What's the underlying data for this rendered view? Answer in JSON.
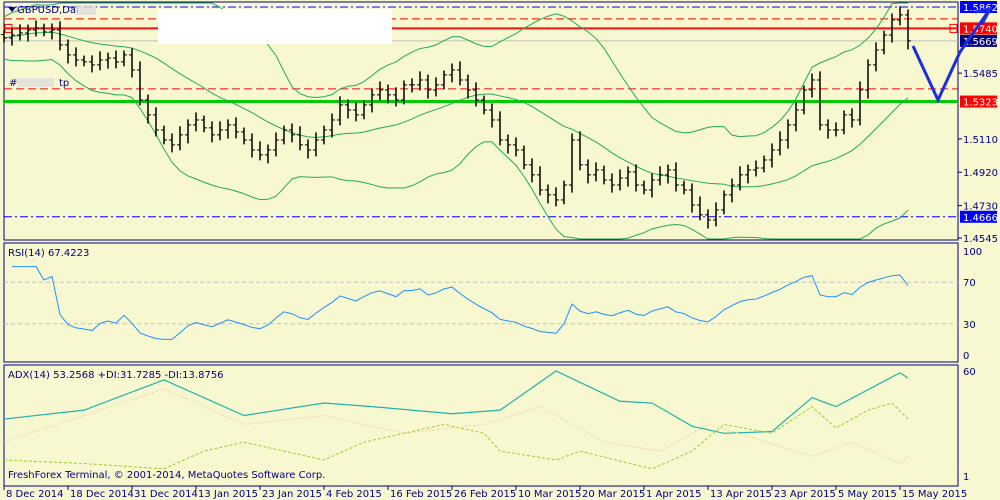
{
  "window": {
    "symbol_label": "GBPUSD,Dai",
    "order_label_prefix": "#",
    "order_label_suffix": "tp",
    "copyright": "FreshForex Terminal, © 2001-2014, MetaQuotes Software Corp."
  },
  "colors": {
    "background": "#f8f8d0",
    "axis": "#000080",
    "bars": "#000000",
    "bands": "#22aa55",
    "rsi": "#1e90ff",
    "adx": "#20b2aa",
    "plus_di": "#9acd32",
    "minus_di": "#f5cba7",
    "support": "#00cc00",
    "resistance": "#ff0000",
    "level_blue": "#0000ff",
    "arrow": "#1a2ee0"
  },
  "chart_data": [
    {
      "type": "ohlc",
      "title": "GBPUSD Daily",
      "ylim": [
        1.4545,
        1.5862
      ],
      "price_ticks": [
        "1.5485",
        "1.5110",
        "1.4920",
        "1.4730",
        "1.4545"
      ],
      "price_labels": [
        {
          "value": 1.5862,
          "text": "1.5862",
          "style": "blue"
        },
        {
          "value": 1.574,
          "text": "1.5740",
          "style": "red"
        },
        {
          "value": 1.5669,
          "text": "1.5669",
          "style": "navy"
        },
        {
          "value": 1.5323,
          "text": "1.5323",
          "style": "red"
        },
        {
          "value": 1.4666,
          "text": "1.4666",
          "style": "blue"
        }
      ],
      "levels": {
        "top_blue": 1.5862,
        "bottom_blue": 1.4666,
        "red_double": 1.574,
        "red_dash_top": 1.5794,
        "red_dash_tp": 1.5395,
        "green_support": 1.5323,
        "current": 1.5669
      },
      "x_labels": [
        {
          "bar": 0,
          "text": "8 Dec 2014"
        },
        {
          "bar": 8,
          "text": "18 Dec 2014"
        },
        {
          "bar": 16,
          "text": "31 Dec 2014"
        },
        {
          "bar": 24,
          "text": "13 Jan 2015"
        },
        {
          "bar": 32,
          "text": "23 Jan 2015"
        },
        {
          "bar": 40,
          "text": "4 Feb 2015"
        },
        {
          "bar": 48,
          "text": "16 Feb 2015"
        },
        {
          "bar": 56,
          "text": "26 Feb 2015"
        },
        {
          "bar": 64,
          "text": "10 Mar 2015"
        },
        {
          "bar": 72,
          "text": "20 Mar 2015"
        },
        {
          "bar": 80,
          "text": "1 Apr 2015"
        },
        {
          "bar": 88,
          "text": "13 Apr 2015"
        },
        {
          "bar": 96,
          "text": "23 Apr 2015"
        },
        {
          "bar": 104,
          "text": "5 May 2015"
        },
        {
          "bar": 112,
          "text": "15 May 2015"
        }
      ],
      "close": [
        1.5685,
        1.5702,
        1.5714,
        1.5731,
        1.5742,
        1.572,
        1.5731,
        1.5646,
        1.5589,
        1.556,
        1.5549,
        1.5532,
        1.556,
        1.5571,
        1.5549,
        1.5589,
        1.5503,
        1.5332,
        1.5247,
        1.5161,
        1.5104,
        1.5076,
        1.5133,
        1.519,
        1.5218,
        1.5173,
        1.5133,
        1.5161,
        1.519,
        1.515,
        1.5104,
        1.5047,
        1.5019,
        1.5047,
        1.5104,
        1.5161,
        1.5133,
        1.5076,
        1.5047,
        1.5104,
        1.5161,
        1.5218,
        1.5304,
        1.5275,
        1.5247,
        1.5304,
        1.5361,
        1.5389,
        1.5361,
        1.5332,
        1.5418,
        1.5418,
        1.5446,
        1.5389,
        1.5418,
        1.5475,
        1.5503,
        1.5446,
        1.5389,
        1.5332,
        1.5275,
        1.5218,
        1.5104,
        1.5076,
        1.5047,
        1.4962,
        1.4905,
        1.4819,
        1.4791,
        1.4762,
        1.4847,
        1.5104,
        1.4962,
        1.4905,
        1.4933,
        1.4876,
        1.4847,
        1.4887,
        1.4922,
        1.4847,
        1.4819,
        1.4876,
        1.4905,
        1.4933,
        1.4847,
        1.4819,
        1.4733,
        1.4677,
        1.4648,
        1.4705,
        1.4791,
        1.4847,
        1.4905,
        1.4933,
        1.4944,
        1.499,
        1.5047,
        1.5104,
        1.519,
        1.5275,
        1.5389,
        1.5446,
        1.519,
        1.5161,
        1.5161,
        1.5247,
        1.5218,
        1.5389,
        1.5532,
        1.5617,
        1.5702,
        1.5788,
        1.5817,
        1.5669
      ]
    },
    {
      "type": "line",
      "title": "RSI(14) 67.4223",
      "ylim": [
        0,
        100
      ],
      "ticks": [
        "100",
        "70",
        "30",
        "0"
      ],
      "levels": [
        70,
        30
      ]
    },
    {
      "type": "line",
      "title": "ADX(14) 53.2568 +DI:31.7285 -DI:13.8756",
      "ylim": [
        1,
        60
      ],
      "ticks": [
        "60",
        "1"
      ],
      "series": [
        {
          "name": "ADX",
          "points": [
            [
              0,
              33
            ],
            [
              10,
              38
            ],
            [
              20,
              55
            ],
            [
              30,
              35
            ],
            [
              40,
              42
            ],
            [
              46,
              40
            ],
            [
              56,
              36
            ],
            [
              62,
              38
            ],
            [
              69,
              60
            ],
            [
              77,
              43
            ],
            [
              81,
              42
            ],
            [
              86,
              29
            ],
            [
              90,
              25
            ],
            [
              96,
              26
            ],
            [
              101,
              45
            ],
            [
              104,
              40
            ],
            [
              112,
              59
            ],
            [
              113,
              56
            ]
          ]
        },
        {
          "name": "+DI",
          "points": [
            [
              0,
              10
            ],
            [
              10,
              8
            ],
            [
              20,
              5
            ],
            [
              25,
              15
            ],
            [
              30,
              20
            ],
            [
              40,
              10
            ],
            [
              45,
              20
            ],
            [
              55,
              30
            ],
            [
              60,
              25
            ],
            [
              62,
              15
            ],
            [
              69,
              10
            ],
            [
              72,
              15
            ],
            [
              81,
              5
            ],
            [
              86,
              15
            ],
            [
              90,
              30
            ],
            [
              96,
              25
            ],
            [
              101,
              40
            ],
            [
              104,
              28
            ],
            [
              108,
              38
            ],
            [
              111,
              42
            ],
            [
              113,
              33
            ]
          ]
        },
        {
          "name": "-DI",
          "points": [
            [
              0,
              20
            ],
            [
              20,
              50
            ],
            [
              30,
              30
            ],
            [
              40,
              35
            ],
            [
              50,
              25
            ],
            [
              60,
              30
            ],
            [
              67,
              40
            ],
            [
              75,
              20
            ],
            [
              82,
              15
            ],
            [
              88,
              30
            ],
            [
              94,
              22
            ],
            [
              101,
              12
            ],
            [
              106,
              20
            ],
            [
              112,
              8
            ],
            [
              113,
              12
            ]
          ]
        }
      ]
    }
  ]
}
